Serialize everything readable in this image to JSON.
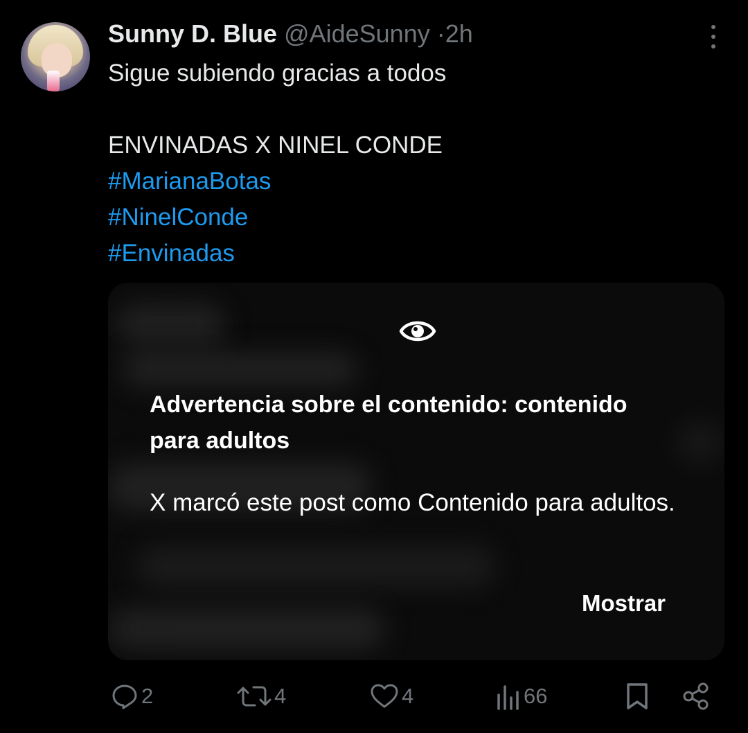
{
  "tweet": {
    "author_name": "Sunny D. Blue",
    "handle": "@AideSunny",
    "separator": "·",
    "time": "2h",
    "lines": [
      "Sigue subiendo gracias a todos",
      "",
      "ENVINADAS X NINEL CONDE"
    ],
    "hashtags": [
      "#MarianaBotas",
      "#NinelConde",
      "#Envinadas"
    ]
  },
  "media_warning": {
    "icon": "eye-icon",
    "title": "Advertencia sobre el contenido: contenido para adultos",
    "text": "X marcó este post como Contenido para adultos.",
    "show_label": "Mostrar"
  },
  "actions": {
    "replies": "2",
    "reposts": "4",
    "likes": "4",
    "views": "66"
  },
  "colors": {
    "background": "#000000",
    "text": "#e7e9ea",
    "muted": "#71767b",
    "link": "#1d9bf0"
  }
}
